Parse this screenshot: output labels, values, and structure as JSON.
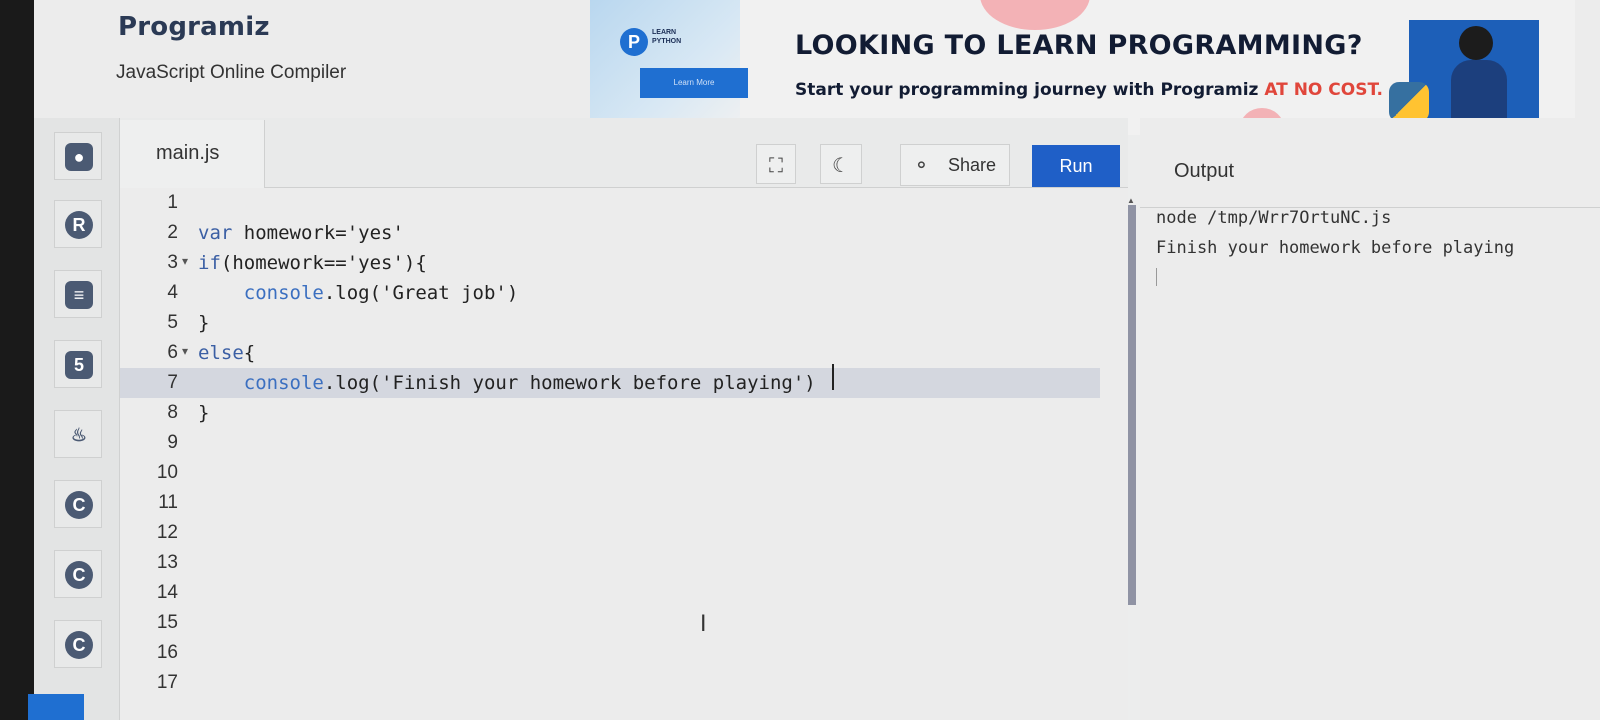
{
  "header": {
    "logo": "Programiz",
    "subtitle": "JavaScript Online Compiler"
  },
  "ad": {
    "badge_letter": "P",
    "badge_text": "LEARN PYTHON",
    "button_label": "Learn More",
    "title": "LOOKING TO LEARN PROGRAMMING?",
    "subtitle_main": "Start your programming journey with Programiz ",
    "subtitle_highlight": "AT NO COST."
  },
  "rail": {
    "items": [
      {
        "icon": "python-icon",
        "glyph": "●",
        "color": "#4b5a73"
      },
      {
        "icon": "r-icon",
        "glyph": "R",
        "color": "#4b5a73"
      },
      {
        "icon": "database-icon",
        "glyph": "≡",
        "color": "#4b5a73"
      },
      {
        "icon": "html5-icon",
        "glyph": "5",
        "color": "#4b5a73"
      },
      {
        "icon": "java-icon",
        "glyph": "♨",
        "color": "#4b5a73"
      },
      {
        "icon": "c-icon",
        "glyph": "C",
        "color": "#4b5a73"
      },
      {
        "icon": "cpp-icon",
        "glyph": "C",
        "color": "#4b5a73"
      },
      {
        "icon": "csharp-icon",
        "glyph": "C",
        "color": "#4b5a73"
      }
    ]
  },
  "editor": {
    "tab_label": "main.js",
    "share_label": "Share",
    "run_label": "Run",
    "active_line": 7,
    "lines": [
      {
        "n": "1",
        "code": ""
      },
      {
        "n": "2",
        "code": "var homework='yes'"
      },
      {
        "n": "3",
        "code": "if(homework=='yes'){",
        "fold": true
      },
      {
        "n": "4",
        "code": "    console.log('Great job')"
      },
      {
        "n": "5",
        "code": "}"
      },
      {
        "n": "6",
        "code": "else{",
        "fold": true
      },
      {
        "n": "7",
        "code": "    console.log('Finish your homework before playing')"
      },
      {
        "n": "8",
        "code": "}"
      },
      {
        "n": "9",
        "code": ""
      },
      {
        "n": "10",
        "code": ""
      },
      {
        "n": "11",
        "code": ""
      },
      {
        "n": "12",
        "code": ""
      },
      {
        "n": "13",
        "code": ""
      },
      {
        "n": "14",
        "code": ""
      },
      {
        "n": "15",
        "code": ""
      },
      {
        "n": "16",
        "code": ""
      },
      {
        "n": "17",
        "code": ""
      }
    ]
  },
  "output": {
    "title": "Output",
    "lines": [
      "node /tmp/Wrr7OrtuNC.js",
      "Finish your homework before playing"
    ]
  },
  "colors": {
    "accent": "#1f5fc7",
    "highlight_row": "#d4d7df",
    "ad_red": "#e0463b"
  }
}
